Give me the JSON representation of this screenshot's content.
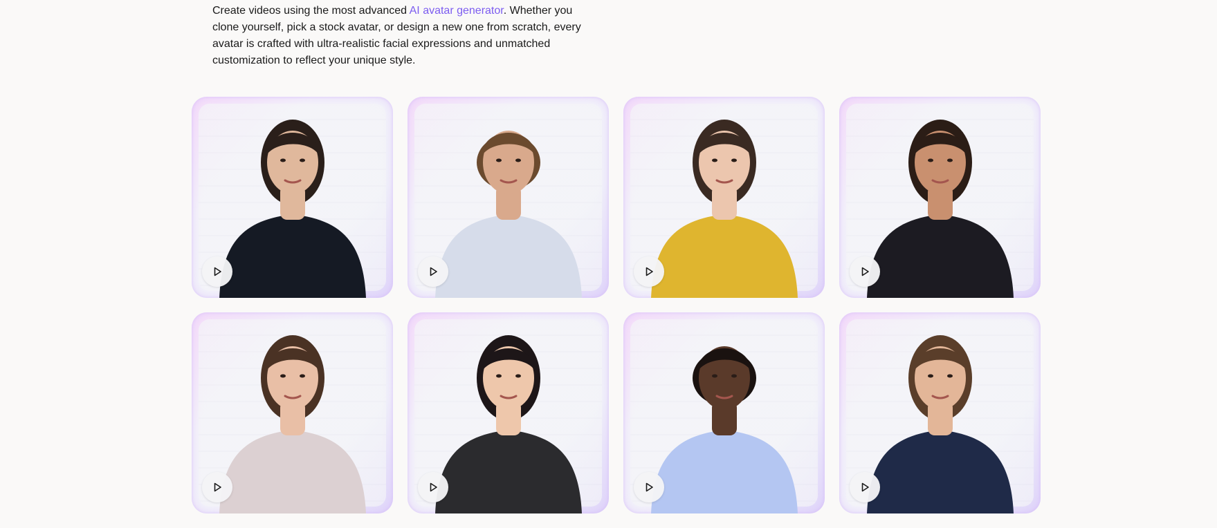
{
  "intro": {
    "before_link": "Create videos using the most advanced ",
    "link_text": "AI avatar generator",
    "after_link": ". Whether you clone yourself, pick a stock avatar, or design a new one from scratch, every avatar is crafted with ultra-realistic facial expressions and unmatched customization to reflect your unique style."
  },
  "colors": {
    "link": "#7c5cf0",
    "background": "#faf9f8"
  },
  "avatars": [
    {
      "name": "avatar-1",
      "icon": "play-icon",
      "skin": "#e0b89c",
      "hair": "#2a1f1a",
      "top": "#151a24"
    },
    {
      "name": "avatar-2",
      "icon": "play-icon",
      "skin": "#d9a98c",
      "hair": "#6b4a2e",
      "top": "#d6dcea"
    },
    {
      "name": "avatar-3",
      "icon": "play-icon",
      "skin": "#ecc6ae",
      "hair": "#3a2a22",
      "top": "#dfb52f"
    },
    {
      "name": "avatar-4",
      "icon": "play-icon",
      "skin": "#c9906f",
      "hair": "#2b1d16",
      "top": "#1c1b22"
    },
    {
      "name": "avatar-5",
      "icon": "play-icon",
      "skin": "#e9bfa6",
      "hair": "#4a3224",
      "top": "#dcd0d2"
    },
    {
      "name": "avatar-6",
      "icon": "play-icon",
      "skin": "#eec7ab",
      "hair": "#1d1618",
      "top": "#2b2b2e"
    },
    {
      "name": "avatar-7",
      "icon": "play-icon",
      "skin": "#5a3a2a",
      "hair": "#1a1210",
      "top": "#b4c6f2"
    },
    {
      "name": "avatar-8",
      "icon": "play-icon",
      "skin": "#e3b698",
      "hair": "#5a3e2a",
      "top": "#1f2a48"
    }
  ]
}
